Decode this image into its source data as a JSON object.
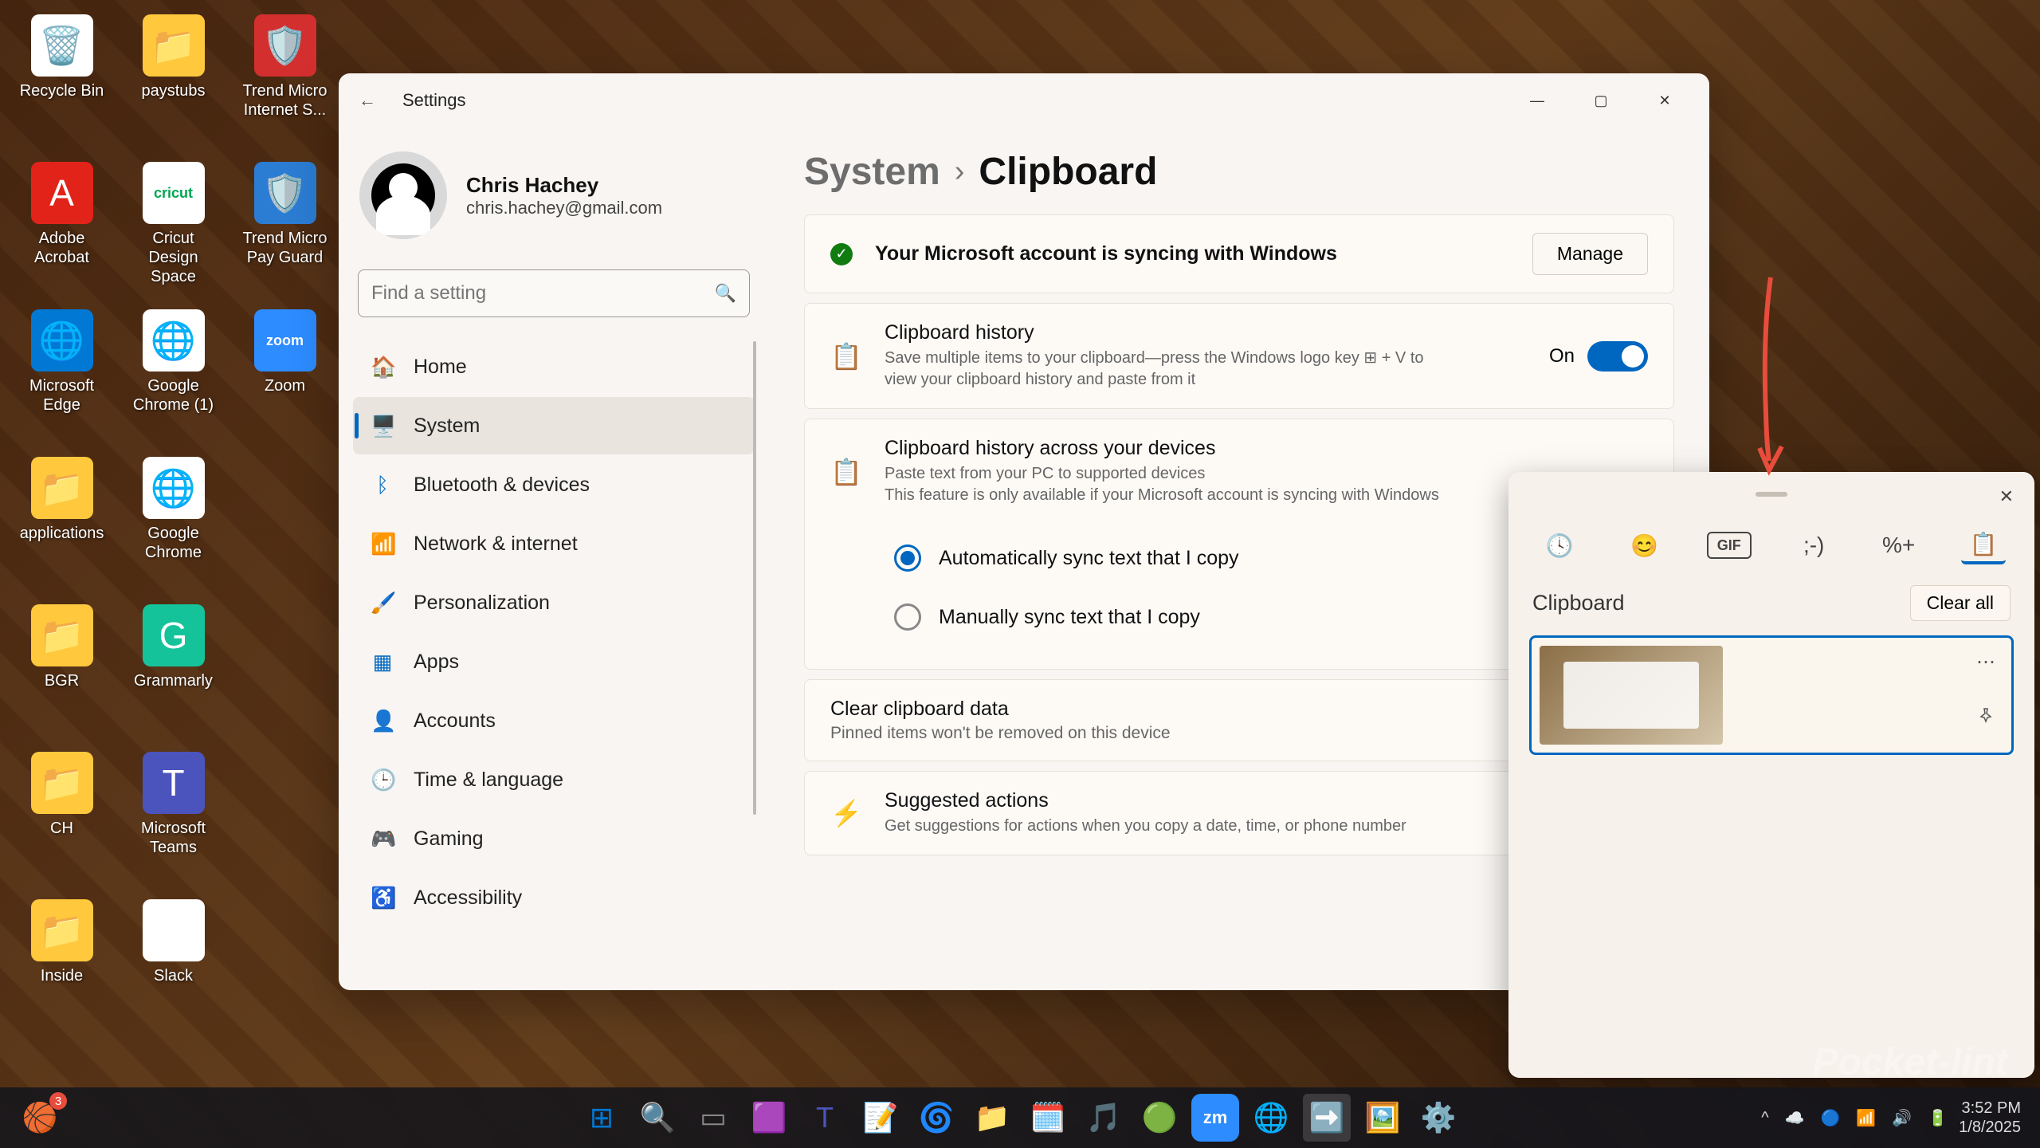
{
  "desktop": {
    "icons": [
      {
        "label": "Recycle Bin",
        "bg": "#ffffff",
        "glyph": "🗑️"
      },
      {
        "label": "paystubs",
        "bg": "#ffc83d",
        "glyph": "📁"
      },
      {
        "label": "Trend Micro Internet S...",
        "bg": "#d32f2f",
        "glyph": "🛡️"
      },
      {
        "label": "Adobe Acrobat",
        "bg": "#e2231a",
        "glyph": "A"
      },
      {
        "label": "Cricut Design Space",
        "bg": "#ffffff",
        "glyph": "cricut",
        "text_color": "#00a651"
      },
      {
        "label": "Trend Micro Pay Guard",
        "bg": "#2b7cd3",
        "glyph": "🛡️"
      },
      {
        "label": "Microsoft Edge",
        "bg": "#0078d4",
        "glyph": "🌐"
      },
      {
        "label": "Google Chrome (1)",
        "bg": "#ffffff",
        "glyph": "🌐"
      },
      {
        "label": "Zoom",
        "bg": "#2d8cff",
        "glyph": "zoom",
        "text_color": "#ffffff"
      },
      {
        "label": "applications",
        "bg": "#ffc83d",
        "glyph": "📁"
      },
      {
        "label": "Google Chrome",
        "bg": "#ffffff",
        "glyph": "🌐"
      },
      {
        "label": "",
        "bg": "transparent",
        "glyph": ""
      },
      {
        "label": "BGR",
        "bg": "#ffc83d",
        "glyph": "📁"
      },
      {
        "label": "Grammarly",
        "bg": "#15c39a",
        "glyph": "G"
      },
      {
        "label": "",
        "bg": "transparent",
        "glyph": ""
      },
      {
        "label": "CH",
        "bg": "#ffc83d",
        "glyph": "📁"
      },
      {
        "label": "Microsoft Teams",
        "bg": "#4b53bc",
        "glyph": "T"
      },
      {
        "label": "",
        "bg": "transparent",
        "glyph": ""
      },
      {
        "label": "Inside",
        "bg": "#ffc83d",
        "glyph": "📁"
      },
      {
        "label": "Slack",
        "bg": "#ffffff",
        "glyph": "✱"
      }
    ]
  },
  "settings": {
    "titlebar": {
      "back": "←",
      "title": "Settings"
    },
    "profile": {
      "name": "Chris Hachey",
      "email": "chris.hachey@gmail.com"
    },
    "search": {
      "placeholder": "Find a setting"
    },
    "nav": [
      {
        "icon": "🏠",
        "label": "Home"
      },
      {
        "icon": "🖥️",
        "label": "System",
        "active": true
      },
      {
        "icon": "ᛒ",
        "label": "Bluetooth & devices",
        "icon_color": "#0067c0"
      },
      {
        "icon": "📶",
        "label": "Network & internet",
        "icon_color": "#0067c0"
      },
      {
        "icon": "🖌️",
        "label": "Personalization"
      },
      {
        "icon": "▦",
        "label": "Apps",
        "icon_color": "#0067c0"
      },
      {
        "icon": "👤",
        "label": "Accounts",
        "icon_color": "#15a85f"
      },
      {
        "icon": "🕒",
        "label": "Time & language"
      },
      {
        "icon": "🎮",
        "label": "Gaming"
      },
      {
        "icon": "♿",
        "label": "Accessibility",
        "icon_color": "#0067c0"
      }
    ],
    "breadcrumb": {
      "parent": "System",
      "sep": "›",
      "current": "Clipboard"
    },
    "sync_banner": {
      "text": "Your Microsoft account is syncing with Windows",
      "button": "Manage"
    },
    "history": {
      "icon": "📋",
      "title": "Clipboard history",
      "desc": "Save multiple items to your clipboard—press the Windows logo key ⊞ + V to view your clipboard history and paste from it",
      "toggle_label": "On"
    },
    "across": {
      "icon": "📋",
      "title": "Clipboard history across your devices",
      "desc": "Paste text from your PC to supported devices",
      "desc2": "This feature is only available if your Microsoft account is syncing with Windows",
      "radio1": "Automatically sync text that I copy",
      "radio2": "Manually sync text that I copy"
    },
    "clear": {
      "title": "Clear clipboard data",
      "desc": "Pinned items won't be removed on this device"
    },
    "suggested": {
      "icon": "⚡",
      "title": "Suggested actions",
      "desc": "Get suggestions for actions when you copy a date, time, or phone number"
    }
  },
  "clipboard_popup": {
    "tabs": [
      "🕓",
      "😊",
      "GIF",
      ";-)",
      "%+",
      "📋"
    ],
    "title": "Clipboard",
    "clear_all": "Clear all",
    "item_more": "⋯",
    "item_pin": "📌"
  },
  "taskbar": {
    "left_badge": "3",
    "apps": [
      "⊞",
      "🔍",
      "▭",
      "🟪",
      "T",
      "📝",
      "🌀",
      "📁",
      "🗓️",
      "🎵",
      "🟢",
      "zm",
      "🌐",
      "➡️",
      "🖼️",
      "⚙️"
    ],
    "tray": [
      "^",
      "☁️",
      "🔵",
      "📶",
      "🔊",
      "🔋"
    ],
    "time": "3:52 PM",
    "date": "1/8/2025"
  },
  "watermark": "Pocket-lint"
}
